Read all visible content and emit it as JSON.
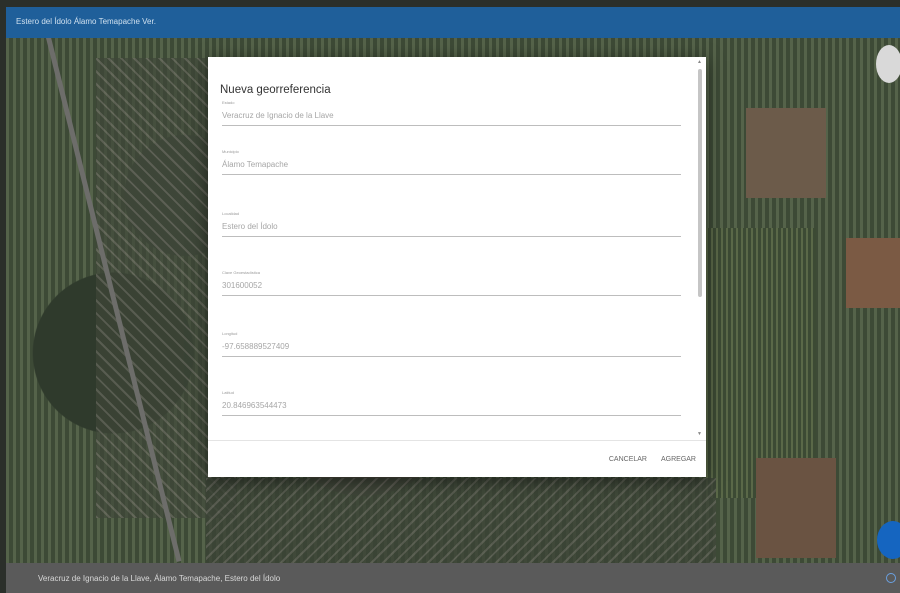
{
  "header": {
    "title": "Estero del Ídolo Álamo Temapache Ver."
  },
  "dialog": {
    "title": "Nueva georreferencia",
    "fields": [
      {
        "label": "Estado",
        "value": "Veracruz de Ignacio de la Llave"
      },
      {
        "label": "Municipio",
        "value": "Álamo Temapache"
      },
      {
        "label": "Localidad",
        "value": "Estero del Ídolo"
      },
      {
        "label": "Clave Geoestadística",
        "value": "301600052"
      },
      {
        "label": "Longitud",
        "value": "-97.658889527409"
      },
      {
        "label": "Latitud",
        "value": "20.846963544473"
      }
    ],
    "cancel_label": "CANCELAR",
    "add_label": "AGREGAR"
  },
  "footer": {
    "location_text": "Veracruz de Ignacio de la Llave, Álamo Temapache, Estero del Ídolo"
  },
  "icons": {
    "locate": "crosshair-icon",
    "scroll_up": "arrow-up-icon",
    "scroll_down": "arrow-down-icon"
  }
}
